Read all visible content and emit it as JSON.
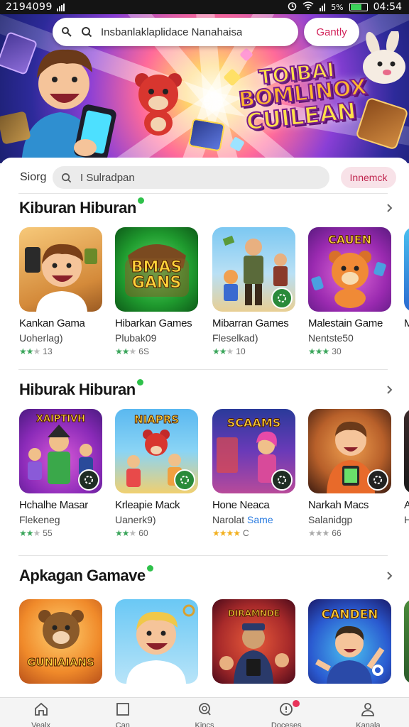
{
  "status": {
    "left_text": "2194099",
    "time": "04:54",
    "percent": "5%"
  },
  "hero": {
    "search_text": "Insbanlaklaplidace Nanahaisa",
    "button_label": "Gantly",
    "title_lines": [
      "TOIBAI",
      "BOMLINOX",
      "CUILEAN"
    ]
  },
  "search": {
    "label": "Siorg",
    "placeholder": "I Sulradpan",
    "button_label": "Innemck"
  },
  "sections": [
    {
      "title": "Kiburan Hiburan",
      "cards": [
        {
          "name": "Kankan Gama",
          "sub": "Uoherlag)",
          "rating": "13",
          "tile_text": ""
        },
        {
          "name": "Hibarkan Games",
          "sub": "Plubak09",
          "rating": "6S",
          "tile_text": "BMAS GANS"
        },
        {
          "name": "Mibarran Games",
          "sub": "Fleselkad)",
          "rating": "10",
          "tile_text": ""
        },
        {
          "name": "Malestain Game",
          "sub": "Nentste50",
          "rating": "30",
          "tile_text": "CAUEN"
        },
        {
          "name": "M",
          "sub": "",
          "rating": "",
          "tile_text": ""
        }
      ]
    },
    {
      "title": "Hiburak Hiburan",
      "cards": [
        {
          "name": "Hchalhe Masar",
          "sub": "Flekeneg",
          "rating": "55",
          "tile_text": "XAIPTIVH"
        },
        {
          "name": "Krleapie Mack",
          "sub": "Uanerk9)",
          "rating": "60",
          "tile_text": "NIAPRS"
        },
        {
          "name": "Hone Neaca",
          "sub": "Narolat",
          "sub_highlight": "Same",
          "rating": "C",
          "tile_text": "SCAAMS"
        },
        {
          "name": "Narkah Macs",
          "sub": "Salanidgp",
          "rating": "66",
          "tile_text": ""
        },
        {
          "name": "A",
          "sub": "H",
          "rating": "",
          "tile_text": ""
        }
      ]
    },
    {
      "title": "Apkagan Gamave",
      "cards": [
        {
          "name": "",
          "sub": "",
          "rating": "",
          "tile_text": "GUNIAIANS"
        },
        {
          "name": "",
          "sub": "",
          "rating": "",
          "tile_text": ""
        },
        {
          "name": "",
          "sub": "",
          "rating": "",
          "tile_text": "DIRAMNDE"
        },
        {
          "name": "",
          "sub": "",
          "rating": "",
          "tile_text": "CANDEN"
        }
      ]
    }
  ],
  "nav": [
    {
      "label": "Vealx",
      "icon": "home-icon"
    },
    {
      "label": "Can",
      "icon": "square-icon"
    },
    {
      "label": "Kincs",
      "icon": "search-icon"
    },
    {
      "label": "Doceses",
      "icon": "info-icon"
    },
    {
      "label": "Kanala",
      "icon": "person-icon"
    }
  ],
  "colors": {
    "accent": "#d2245b",
    "dot_green": "#2ec14a",
    "star_green": "#3aa55a",
    "star_gold": "#f2b01e"
  }
}
